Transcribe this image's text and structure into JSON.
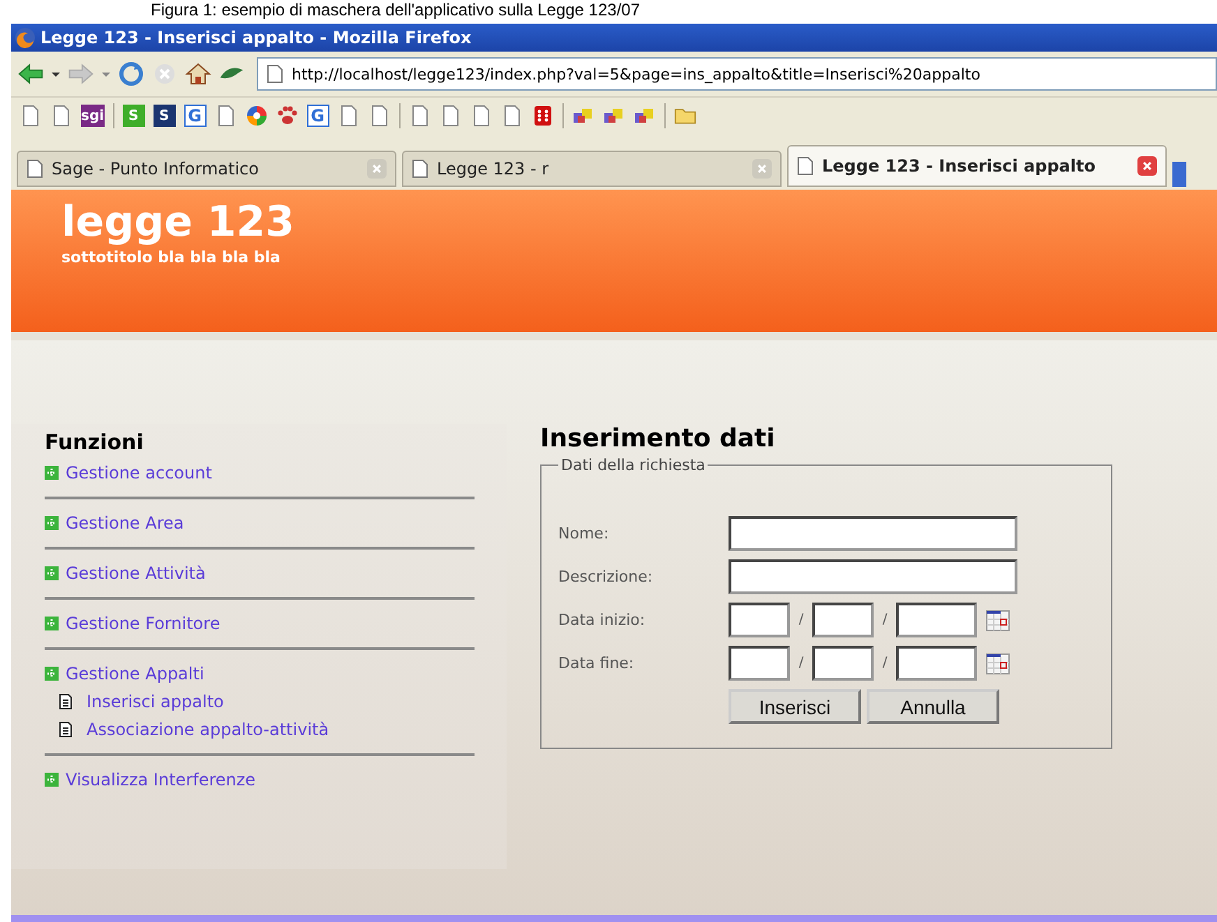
{
  "caption": "Figura 1: esempio di maschera dell'applicativo sulla Legge 123/07",
  "window": {
    "title": "Legge 123 - Inserisci appalto - Mozilla Firefox"
  },
  "address": {
    "value": "http://localhost/legge123/index.php?val=5&page=ins_appalto&title=Inserisci%20appalto"
  },
  "bookmarks": [
    {
      "kind": "page"
    },
    {
      "kind": "page"
    },
    {
      "kind": "badge",
      "label": "sgi",
      "color": "#7a2a86"
    },
    {
      "kind": "separator"
    },
    {
      "kind": "badge",
      "label": "S",
      "color": "#3fae2a"
    },
    {
      "kind": "badge",
      "label": "S",
      "color": "#1b3570"
    },
    {
      "kind": "outline",
      "label": "G",
      "color": "#2f6fd6"
    },
    {
      "kind": "page"
    },
    {
      "kind": "wheel"
    },
    {
      "kind": "paw"
    },
    {
      "kind": "outline",
      "label": "G",
      "color": "#2f6fd6"
    },
    {
      "kind": "page"
    },
    {
      "kind": "page"
    },
    {
      "kind": "separator"
    },
    {
      "kind": "page"
    },
    {
      "kind": "page"
    },
    {
      "kind": "page"
    },
    {
      "kind": "page"
    },
    {
      "kind": "dice"
    },
    {
      "kind": "separator"
    },
    {
      "kind": "puzzle"
    },
    {
      "kind": "puzzle"
    },
    {
      "kind": "puzzle"
    },
    {
      "kind": "separator"
    },
    {
      "kind": "folder"
    }
  ],
  "tabs": [
    {
      "label": "Sage - Punto Informatico",
      "selected": false
    },
    {
      "label": "Legge 123 - r",
      "selected": false
    },
    {
      "label": "Legge 123 - Inserisci appalto",
      "selected": true
    }
  ],
  "header": {
    "title": "legge 123",
    "subtitle": "sottotitolo bla bla bla bla"
  },
  "sidebar": {
    "title": "Funzioni",
    "items": [
      {
        "label": "Gestione account"
      },
      {
        "label": "Gestione Area"
      },
      {
        "label": "Gestione Attività"
      },
      {
        "label": "Gestione Fornitore"
      },
      {
        "label": "Gestione Appalti",
        "children": [
          {
            "label": "Inserisci appalto"
          },
          {
            "label": "Associazione appalto-attività"
          }
        ]
      },
      {
        "label": "Visualizza Interferenze"
      }
    ]
  },
  "form": {
    "title": "Inserimento dati",
    "legend": "Dati della richiesta",
    "fields": [
      {
        "label": "Nome:",
        "kind": "text"
      },
      {
        "label": "Descrizione:",
        "kind": "text"
      },
      {
        "label": "Data inizio:",
        "kind": "date",
        "separator": "/"
      },
      {
        "label": "Data fine:",
        "kind": "date",
        "separator": "/"
      }
    ],
    "buttons": [
      "Inserisci",
      "Annulla"
    ]
  }
}
